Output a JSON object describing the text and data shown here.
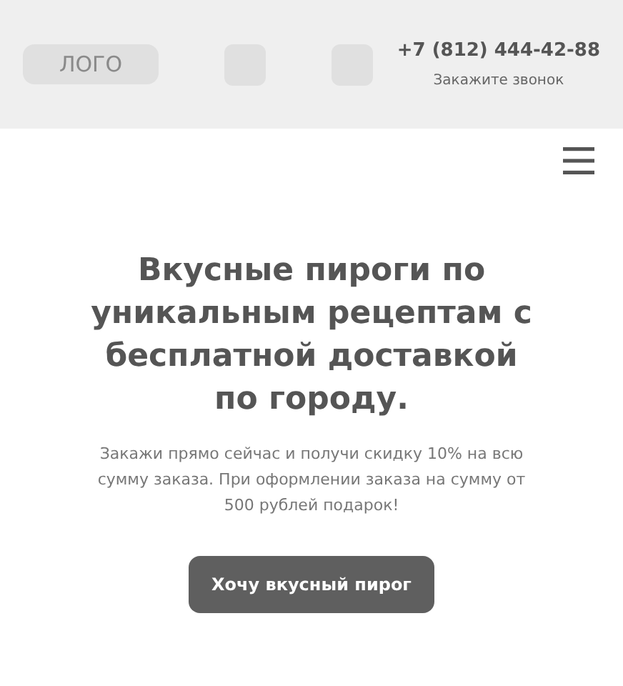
{
  "header": {
    "logo": "ЛОГО",
    "phone": "+7 (812) 444-42-88",
    "callback": "Закажите звонок"
  },
  "hero": {
    "title": "Вкусные пироги по уникальным рецептам с бесплатной доставкой по городу.",
    "text": "Закажи прямо сейчас и получи скидку 10% на всю сумму заказа. При оформлении заказа на сумму от 500 рублей подарок!",
    "button": "Хочу вкусный пирог"
  }
}
